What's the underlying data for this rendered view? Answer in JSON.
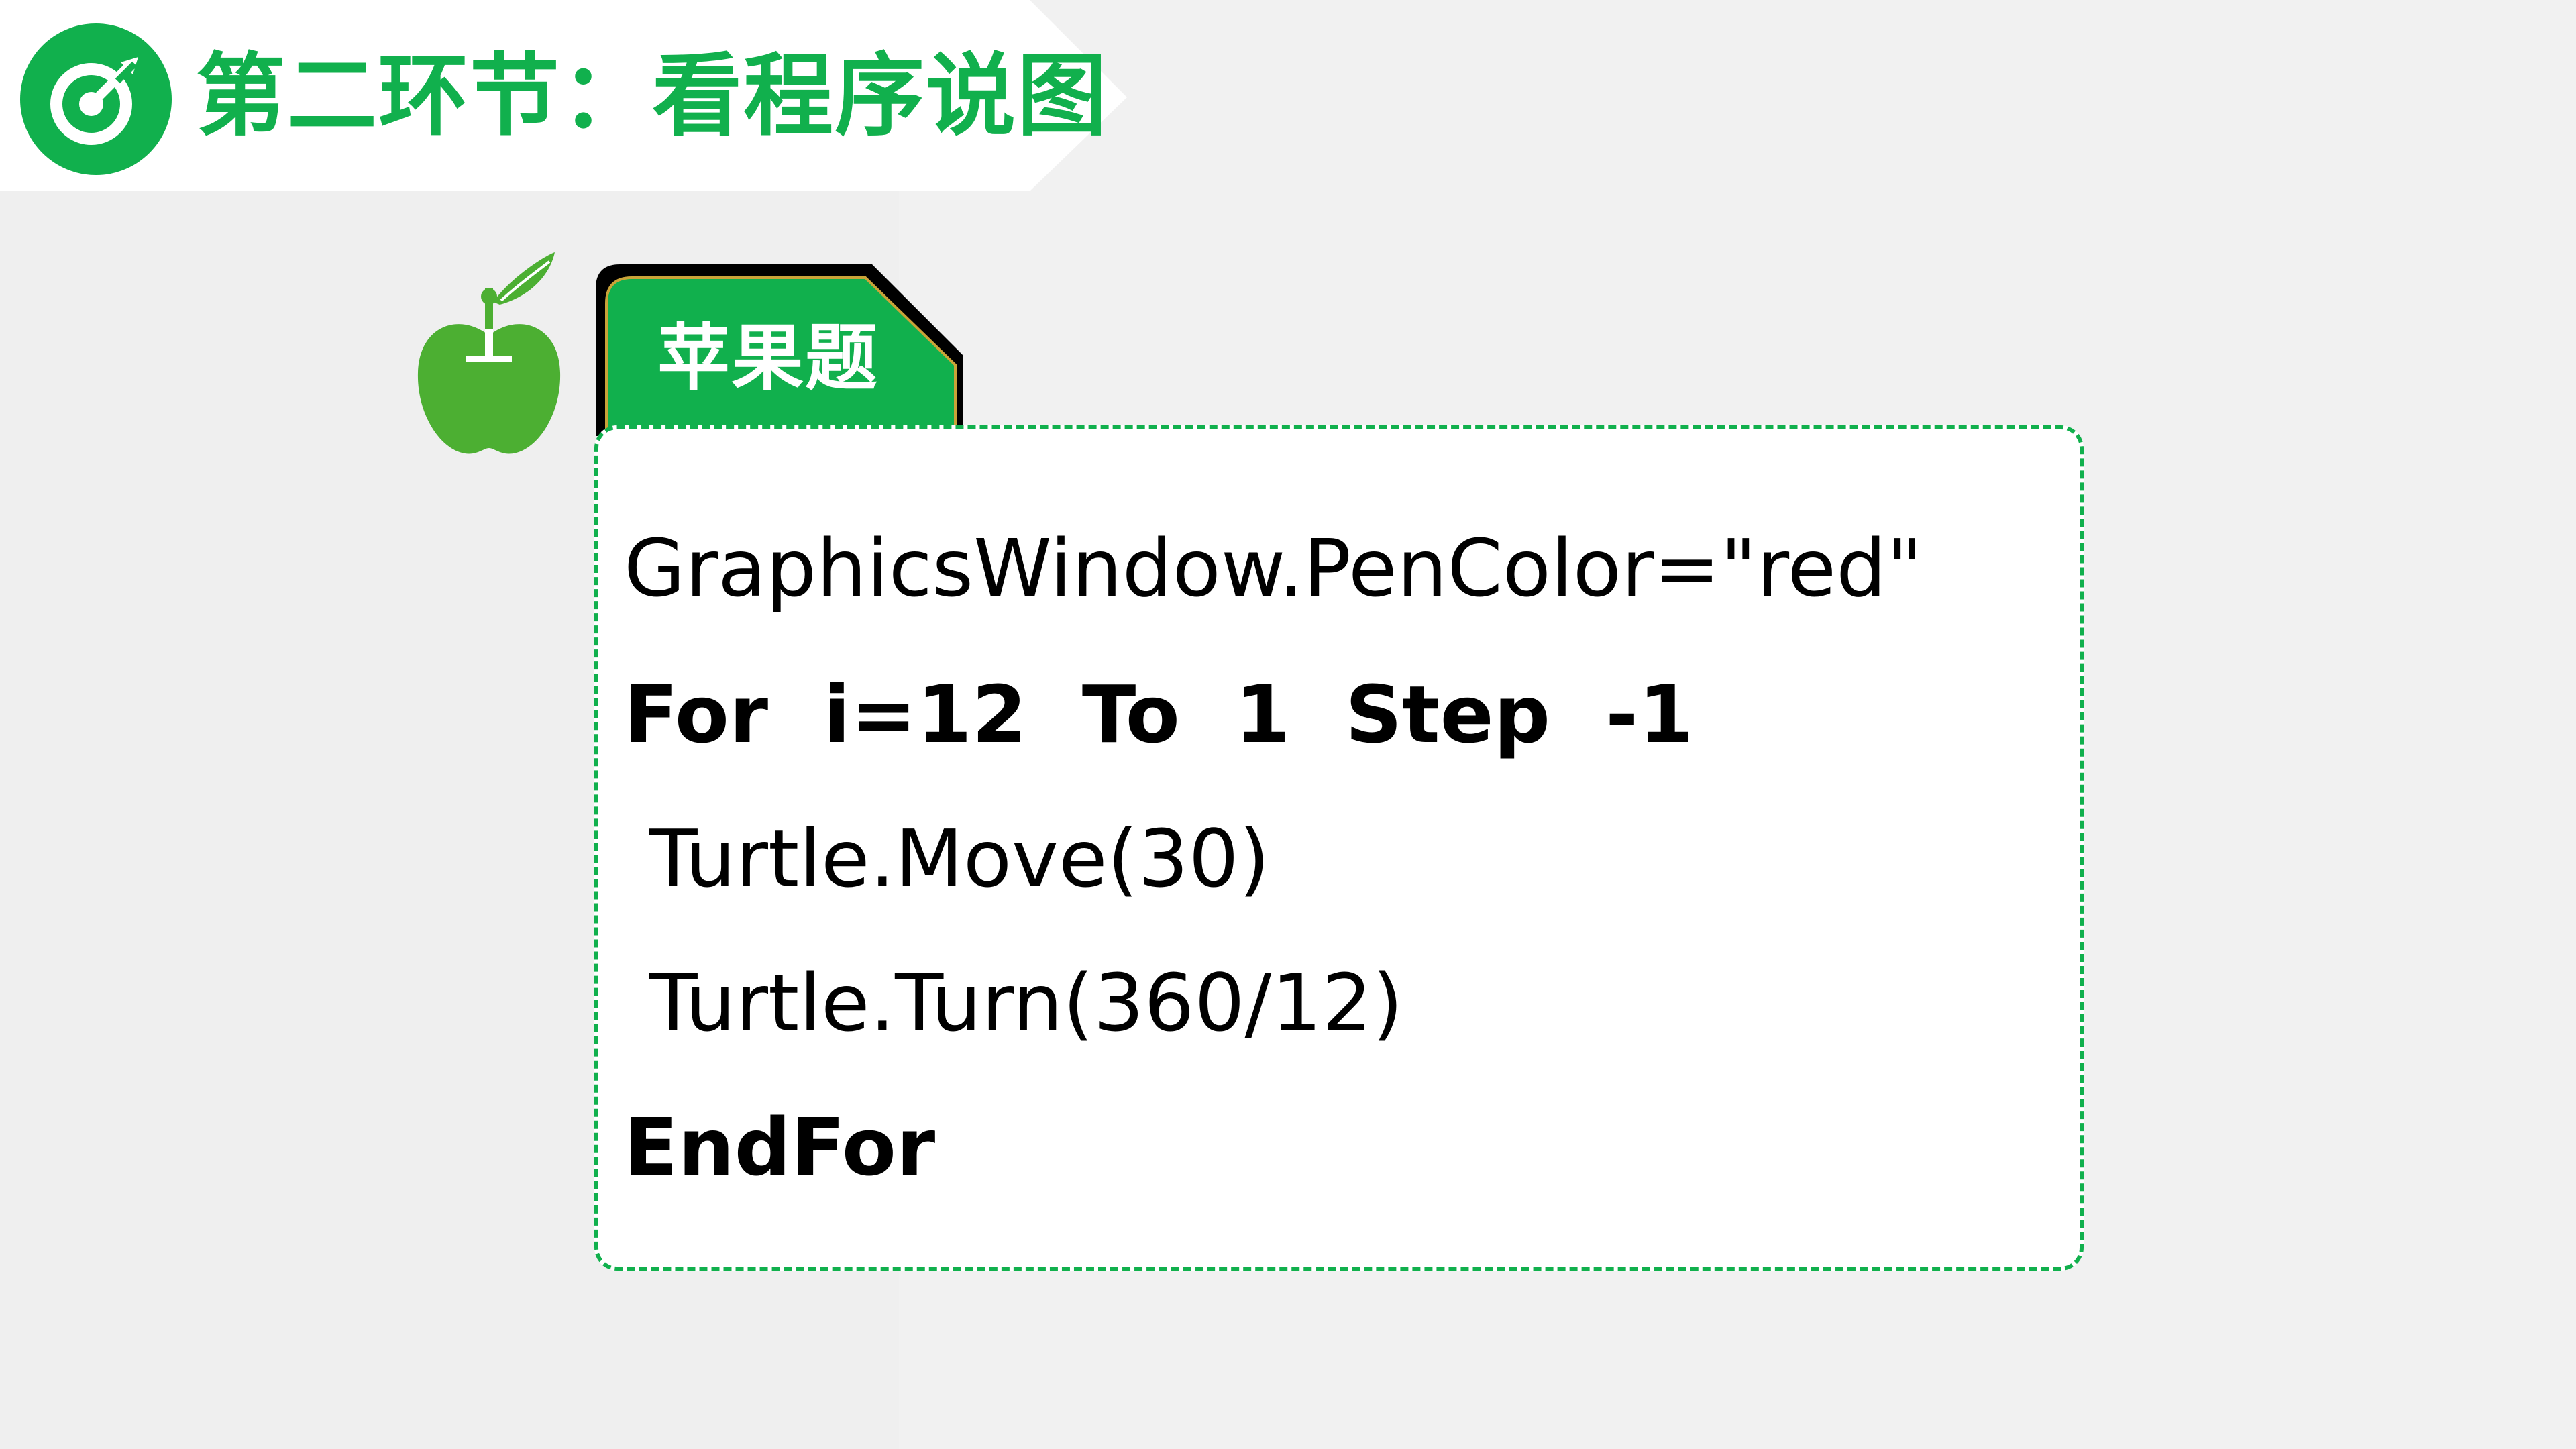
{
  "header": {
    "title": "第二环节：看程序说图",
    "icon": "target-icon",
    "accent_color": "#11b04d"
  },
  "card": {
    "tab_label": "苹果题",
    "tab_icon": "apple-icon",
    "code_lines": [
      {
        "text": "GraphicsWindow.PenColor=\"red\"",
        "bold": false
      },
      {
        "text": "For  i=12  To  1  Step  -1",
        "bold": true
      },
      {
        "text": " Turtle.Move(30)",
        "bold": false
      },
      {
        "text": " Turtle.Turn(360/12)",
        "bold": false
      },
      {
        "text": "EndFor",
        "bold": true
      }
    ]
  }
}
